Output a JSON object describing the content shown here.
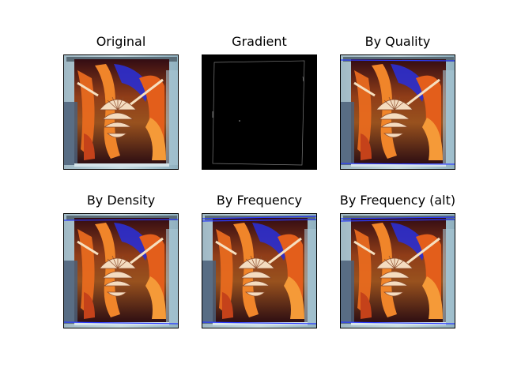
{
  "panels": [
    {
      "title": "Original",
      "kind": "photo",
      "lines": []
    },
    {
      "title": "Gradient",
      "kind": "gradient",
      "lines": []
    },
    {
      "title": "By Quality",
      "kind": "photo",
      "lines": [
        "top",
        "bottom"
      ]
    },
    {
      "title": "By Density",
      "kind": "photo",
      "lines": [
        "top",
        "bottom"
      ]
    },
    {
      "title": "By Frequency",
      "kind": "photo",
      "lines": [
        "top",
        "top2",
        "bottom"
      ]
    },
    {
      "title": "By Frequency (alt)",
      "kind": "photo",
      "lines": [
        "top",
        "top2",
        "bottom"
      ]
    }
  ],
  "colors": {
    "detected_line": "#2a3cff",
    "gradient_bg": "#000000",
    "gradient_edge": "#7a7a7a"
  }
}
